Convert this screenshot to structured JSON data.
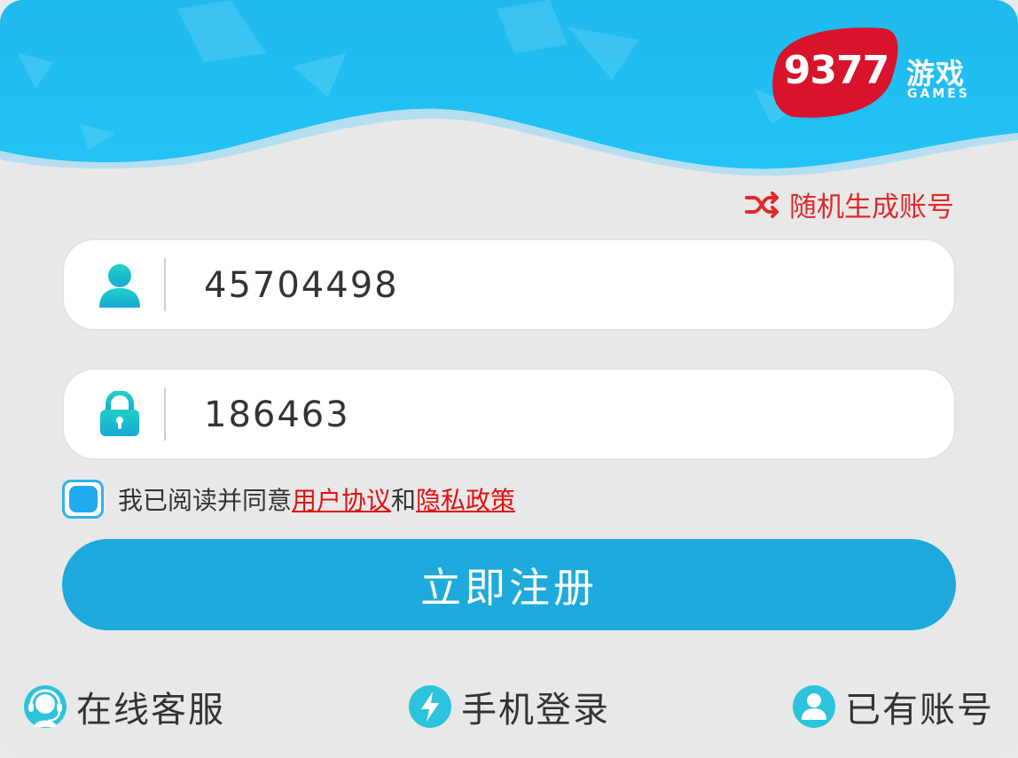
{
  "logo": {
    "number": "9377",
    "name_cn": "游戏",
    "name_en": "GAMES"
  },
  "random_account": {
    "label": "随机生成账号",
    "icon": "shuffle-icon"
  },
  "username": {
    "value": "45704498",
    "icon": "user-icon"
  },
  "password": {
    "value": "186463",
    "icon": "lock-icon"
  },
  "agreement": {
    "checked": true,
    "prefix": "我已阅读并同意",
    "user_agreement": "用户协议",
    "joiner": "和",
    "privacy_policy": "隐私政策"
  },
  "register_button": {
    "label": "立即注册"
  },
  "bottom": {
    "service": {
      "label": "在线客服",
      "icon": "headset-icon"
    },
    "phone_login": {
      "label": "手机登录",
      "icon": "lightning-icon"
    },
    "have_account": {
      "label": "已有账号",
      "icon": "person-icon"
    }
  },
  "colors": {
    "header_blue": "#1dbff1",
    "accent_blue": "#1eaadc",
    "link_red": "#e01010",
    "logo_red": "#d8132b",
    "icon_teal": "#1cc1d8"
  }
}
